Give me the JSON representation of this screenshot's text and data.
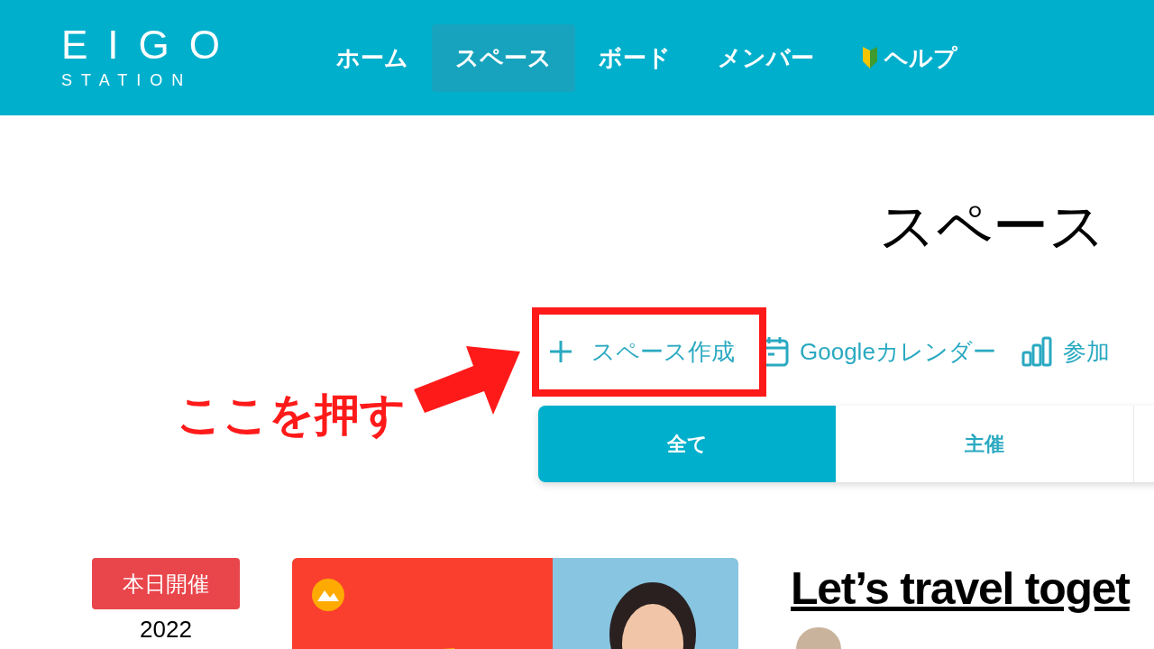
{
  "header": {
    "logo": {
      "line_1": "EIGO",
      "line_2": "STATION"
    },
    "nav": [
      {
        "label": "ホーム",
        "selected": false
      },
      {
        "label": "スペース",
        "selected": true
      },
      {
        "label": "ボード",
        "selected": false
      },
      {
        "label": "メンバー",
        "selected": false
      },
      {
        "label": "ヘルプ",
        "selected": false,
        "kind": "help"
      }
    ]
  },
  "page_title": "スペース",
  "actions": [
    {
      "kind": "create",
      "label": "スペース作成"
    },
    {
      "kind": "calendar",
      "label": "Googleカレンダー"
    },
    {
      "kind": "chart",
      "label": "参加"
    }
  ],
  "filter_tabs": [
    {
      "label": "全て",
      "selected": true
    },
    {
      "label": "主催",
      "selected": false
    }
  ],
  "events": [
    {
      "badge": "本日開催",
      "year": "2022",
      "title": "Let’s travel toget"
    }
  ],
  "annotation": {
    "label": "ここを押す"
  }
}
